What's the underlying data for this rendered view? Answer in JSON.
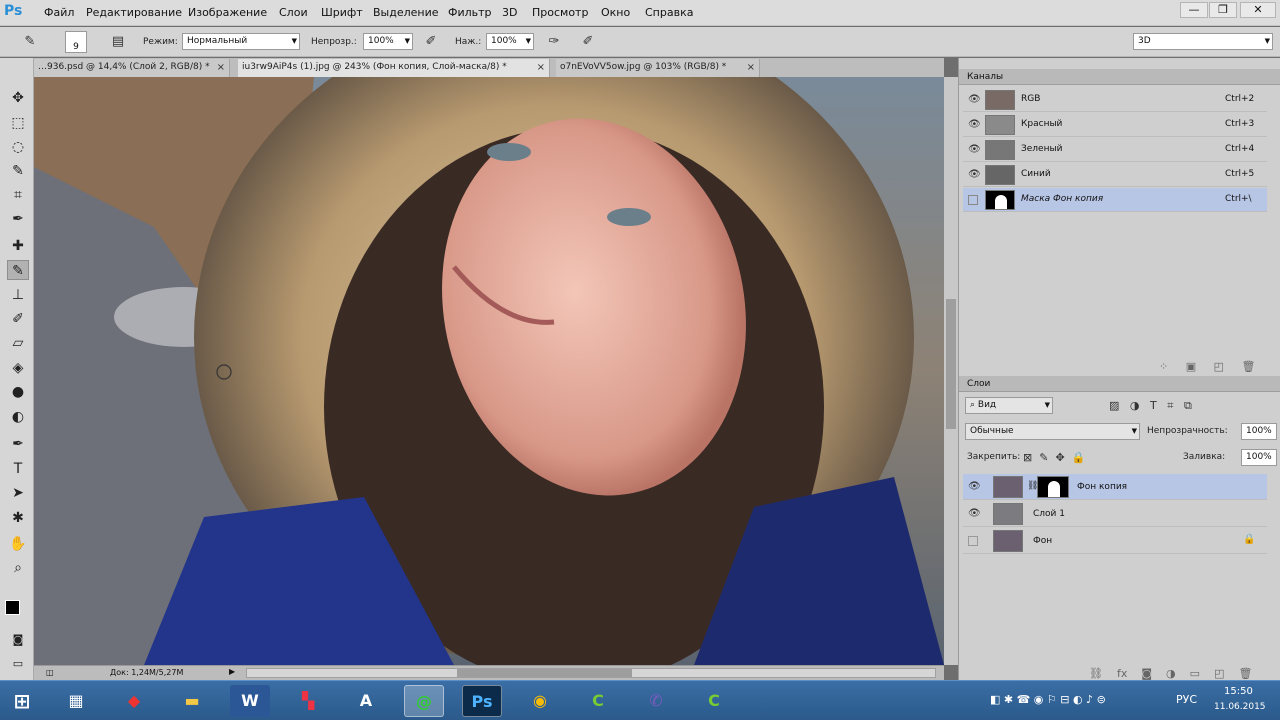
{
  "app": {
    "logo": "Ps"
  },
  "menu": [
    "Файл",
    "Редактирование",
    "Изображение",
    "Слои",
    "Шрифт",
    "Выделение",
    "Фильтр",
    "3D",
    "Просмотр",
    "Окно",
    "Справка"
  ],
  "window_controls": {
    "minimize": "—",
    "restore": "❐",
    "close": "✕"
  },
  "options": {
    "brush_size": "9",
    "mode_label": "Режим:",
    "mode_value": "Нормальный",
    "opacity_label": "Непрозр.:",
    "opacity_value": "100%",
    "flow_label": "Наж.:",
    "flow_value": "100%",
    "workspace": "3D"
  },
  "tabs": [
    {
      "label": "…936.psd @ 14,4% (Слой 2, RGB/8) *",
      "close": "×"
    },
    {
      "label": "iu3rw9AiP4s (1).jpg @ 243% (Фон копия, Слой-маска/8) *",
      "close": "×"
    },
    {
      "label": "o7nEVoVV5ow.jpg @ 103% (RGB/8) *",
      "close": "×"
    }
  ],
  "status": {
    "doc": "Док: 1,24M/5,27M"
  },
  "channels": {
    "title": "Каналы",
    "rows": [
      {
        "name": "RGB",
        "shortcut": "Ctrl+2"
      },
      {
        "name": "Красный",
        "shortcut": "Ctrl+3"
      },
      {
        "name": "Зеленый",
        "shortcut": "Ctrl+4"
      },
      {
        "name": "Синий",
        "shortcut": "Ctrl+5"
      },
      {
        "name": "Маска Фон копия",
        "shortcut": "Ctrl+\\"
      }
    ]
  },
  "layers": {
    "title": "Слои",
    "filter": "Вид",
    "blend": "Обычные",
    "opacity_label": "Непрозрачность:",
    "opacity_value": "100%",
    "lock_label": "Закрепить:",
    "fill_label": "Заливка:",
    "fill_value": "100%",
    "rows": [
      {
        "name": "Фон копия"
      },
      {
        "name": "Слой 1"
      },
      {
        "name": "Фон"
      }
    ]
  },
  "taskbar": {
    "lang": "РУС",
    "time": "15:50",
    "date": "11.06.2015"
  },
  "colors": {
    "accent": "#2b8fd6",
    "selection": "#b8c6e6"
  }
}
